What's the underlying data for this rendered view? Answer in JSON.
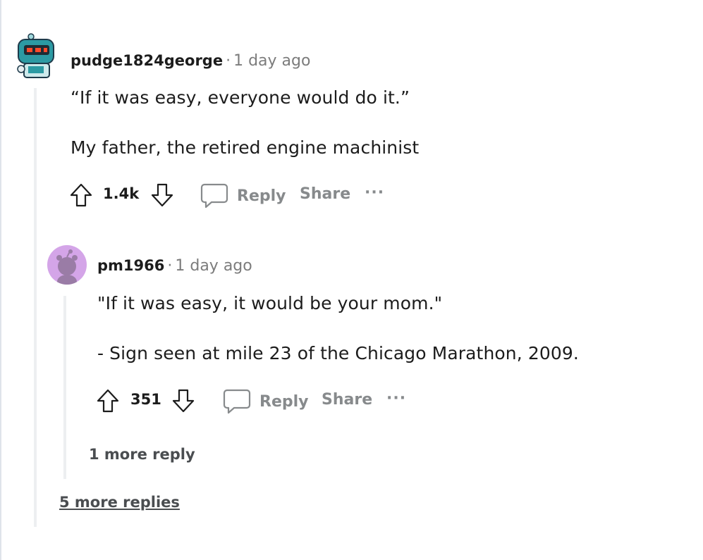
{
  "comments": [
    {
      "username": "pudge1824george",
      "separator": "·",
      "timestamp": "1 day ago",
      "lines": [
        "“If it was easy, everyone would do it.”",
        "My father, the retired engine machinist"
      ],
      "votes": "1.4k",
      "reply_label": "Reply",
      "share_label": "Share",
      "more_label": "···"
    },
    {
      "username": "pm1966",
      "separator": "·",
      "timestamp": "1 day ago",
      "lines": [
        "\"If it was easy, it would be your mom.\"",
        "- Sign seen at mile 23 of the Chicago Marathon, 2009."
      ],
      "votes": "351",
      "reply_label": "Reply",
      "share_label": "Share",
      "more_label": "···"
    }
  ],
  "nested_more_replies": "1 more reply",
  "top_more_replies": "5 more replies",
  "colors": {
    "avatar_robot_bg": "#2c9aa3",
    "avatar_snoo_bg": "#d4a5e8",
    "muted": "#878a8c",
    "thread_line": "#edeff1"
  }
}
